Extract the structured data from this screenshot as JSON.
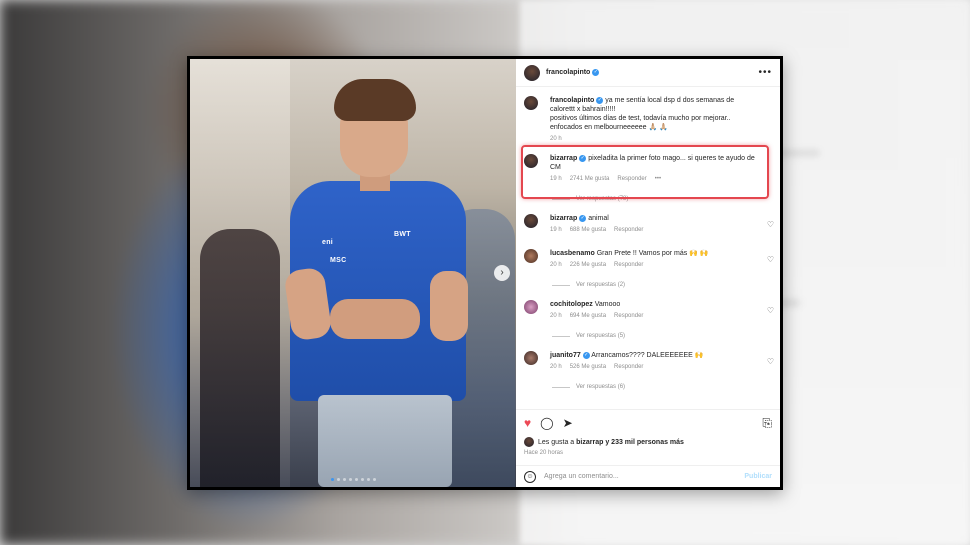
{
  "post": {
    "author": "francolapinto",
    "caption_author": "francolapinto",
    "caption": "ya me sentía local dsp d dos semanas de calorettt x bahrain!!!!!",
    "caption_line2": "positivos últimos días de test, todavía mucho por mejorar..",
    "caption_line3": "enfocados en melbourneeeeee 🙏🏼 🙏🏼",
    "caption_time": "20 h"
  },
  "comments": [
    {
      "user": "bizarrap",
      "text": "pixeladita la primer foto mago... si queres te ayudo de CM",
      "time": "19 h",
      "likes": "2741 Me gusta",
      "reply": "Responder",
      "more": "•••",
      "view_replies": "Ver respuestas (78)"
    },
    {
      "user": "bizarrap",
      "text": "animal",
      "time": "19 h",
      "likes": "688 Me gusta",
      "reply": "Responder"
    },
    {
      "user": "lucasbenamo",
      "text": "Gran Prete !! Vamos por más 🙌 🙌",
      "time": "20 h",
      "likes": "226 Me gusta",
      "reply": "Responder",
      "view_replies": "Ver respuestas (2)"
    },
    {
      "user": "cochitolopez",
      "text": "Vamooo",
      "time": "20 h",
      "likes": "694 Me gusta",
      "reply": "Responder",
      "view_replies": "Ver respuestas (5)"
    },
    {
      "user": "juanito77",
      "text": "Arrancamos???? DALEEEEEEE 🙌",
      "time": "20 h",
      "likes": "526 Me gusta",
      "reply": "Responder",
      "view_replies": "Ver respuestas (6)"
    }
  ],
  "likes": {
    "prefix": "Les gusta a",
    "user": "bizarrap",
    "suffix": "y 233 mil personas más"
  },
  "timestamp": "Hace 20 horas",
  "add_comment": {
    "placeholder": "Agrega un comentario...",
    "post": "Publicar"
  },
  "photo": {
    "sponsor1": "eni",
    "sponsor2": "MSC",
    "sponsor3": "BWT"
  },
  "icons": {
    "heart": "heart-icon",
    "comment": "comment-icon",
    "share": "share-icon",
    "save": "bookmark-icon"
  },
  "colors": {
    "highlight": "#e4474f",
    "like": "#ed4956",
    "verified": "#3897f0"
  }
}
